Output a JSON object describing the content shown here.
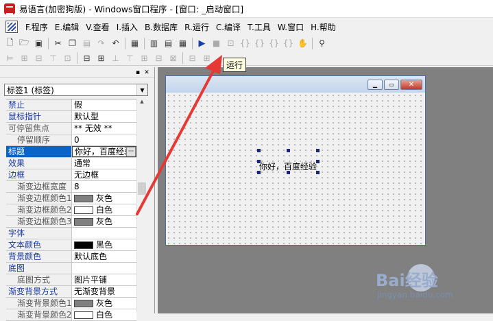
{
  "window": {
    "title": "易语言(加密狗版) - Windows窗口程序 - [窗口: _启动窗口]"
  },
  "menu": [
    {
      "label": "F.程序"
    },
    {
      "label": "E.编辑"
    },
    {
      "label": "V.查看"
    },
    {
      "label": "I.插入"
    },
    {
      "label": "B.数据库"
    },
    {
      "label": "R.运行"
    },
    {
      "label": "C.编译"
    },
    {
      "label": "T.工具"
    },
    {
      "label": "W.窗口"
    },
    {
      "label": "H.帮助"
    }
  ],
  "tooltip": "运行",
  "property_panel": {
    "selector_value": "标签1 (标签)",
    "rows": [
      {
        "key": "禁止",
        "value": "假"
      },
      {
        "key": "鼠标指针",
        "value": "默认型"
      },
      {
        "key": "可停留焦点",
        "value": "** 无效 **"
      },
      {
        "key": "停留顺序",
        "value": "0"
      },
      {
        "key": "标题",
        "value": "你好，百度经验"
      },
      {
        "key": "效果",
        "value": "通常"
      },
      {
        "key": "边框",
        "value": "无边框"
      },
      {
        "key": "渐变边框宽度",
        "value": "8"
      },
      {
        "key": "渐变边框颜色1",
        "value": "灰色",
        "color": "#808080"
      },
      {
        "key": "渐变边框颜色2",
        "value": "白色",
        "color": "#ffffff"
      },
      {
        "key": "渐变边框颜色3",
        "value": "灰色",
        "color": "#808080"
      },
      {
        "key": "字体",
        "value": ""
      },
      {
        "key": "文本颜色",
        "value": "黑色",
        "color": "#000000"
      },
      {
        "key": "背景颜色",
        "value": "默认底色"
      },
      {
        "key": "底图",
        "value": ""
      },
      {
        "key": "底图方式",
        "value": "图片平铺"
      },
      {
        "key": "渐变背景方式",
        "value": "无渐变背景"
      },
      {
        "key": "渐变背景颜色1",
        "value": "灰色",
        "color": "#808080"
      },
      {
        "key": "渐变背景颜色2",
        "value": "白色",
        "color": "#ffffff"
      }
    ]
  },
  "designer": {
    "label_text": "你好，百度经验"
  },
  "watermark": {
    "brand": "Bai经验",
    "url": "jingyan.baidu.com"
  },
  "colors": {
    "selection": "#0a64c8",
    "arrow": "#e53935",
    "run_icon": "#1a3fb0"
  }
}
